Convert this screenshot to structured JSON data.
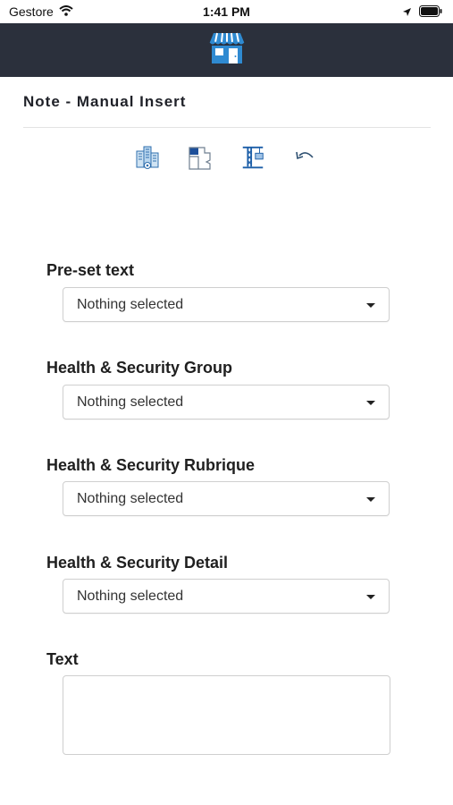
{
  "status_bar": {
    "carrier": "Gestore",
    "time": "1:41 PM"
  },
  "header": {
    "icon": "store-icon",
    "accent_color": "#2b303c",
    "icon_color": "#2f8ad1"
  },
  "page": {
    "title": "Note - Manual Insert"
  },
  "toolbar": {
    "icons": [
      "buildings-icon",
      "floor-plan-icon",
      "crane-icon",
      "undo-icon"
    ]
  },
  "form": {
    "preset_text": {
      "label": "Pre-set text",
      "value": "Nothing selected"
    },
    "hs_group": {
      "label": "Health & Security Group",
      "value": "Nothing selected"
    },
    "hs_rubrique": {
      "label": "Health & Security Rubrique",
      "value": "Nothing selected"
    },
    "hs_detail": {
      "label": "Health & Security Detail",
      "value": "Nothing selected"
    },
    "text": {
      "label": "Text",
      "value": ""
    }
  }
}
